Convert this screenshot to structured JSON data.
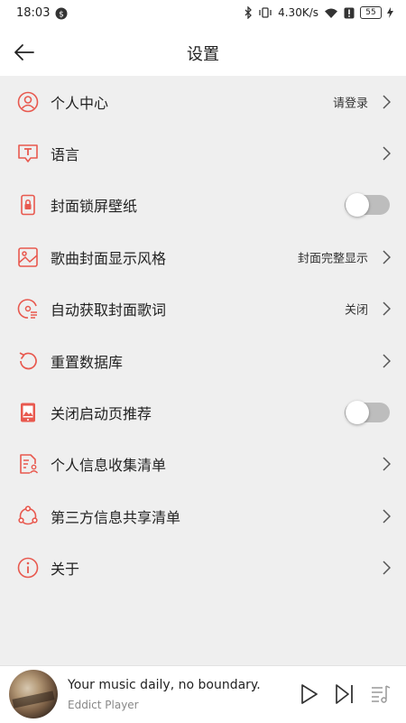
{
  "status_bar": {
    "time": "18:03",
    "network_speed": "4.30K/s",
    "battery": "55"
  },
  "header": {
    "title": "设置"
  },
  "settings": [
    {
      "label": "个人中心",
      "value": "请登录",
      "control": "chevron",
      "icon": "person-icon"
    },
    {
      "label": "语言",
      "value": "",
      "control": "chevron",
      "icon": "language-icon"
    },
    {
      "label": "封面锁屏壁纸",
      "value": "",
      "control": "toggle",
      "toggle_on": false,
      "icon": "lock-screen-icon"
    },
    {
      "label": "歌曲封面显示风格",
      "value": "封面完整显示",
      "control": "chevron",
      "icon": "image-style-icon"
    },
    {
      "label": "自动获取封面歌词",
      "value": "关闭",
      "control": "chevron",
      "icon": "disc-lyrics-icon"
    },
    {
      "label": "重置数据库",
      "value": "",
      "control": "chevron",
      "icon": "reset-icon"
    },
    {
      "label": "关闭启动页推荐",
      "value": "",
      "control": "toggle",
      "toggle_on": false,
      "icon": "splash-icon"
    },
    {
      "label": "个人信息收集清单",
      "value": "",
      "control": "chevron",
      "icon": "personal-info-icon"
    },
    {
      "label": "第三方信息共享清单",
      "value": "",
      "control": "chevron",
      "icon": "share-icon"
    },
    {
      "label": "关于",
      "value": "",
      "control": "chevron",
      "icon": "info-icon"
    }
  ],
  "player": {
    "title": "Your music daily, no boundary.",
    "subtitle": "Eddict Player"
  },
  "colors": {
    "accent": "#e8594f",
    "background": "#efefef",
    "toggle_off": "#bdbdbd"
  }
}
